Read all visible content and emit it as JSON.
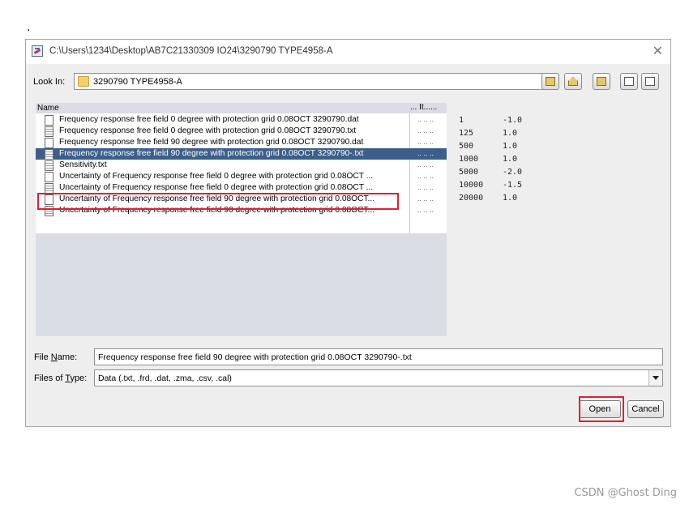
{
  "page_mark": ".",
  "window": {
    "title": "C:\\Users\\1234\\Desktop\\AB7C21330309 IO24\\3290790 TYPE4958-A",
    "close_glyph": "✕",
    "icon": "java-app-icon"
  },
  "look_in": {
    "label": "Look In:",
    "value": "3290790 TYPE4958-A",
    "icon": "folder-icon"
  },
  "toolbar": {
    "buttons": [
      "up-folder-icon",
      "home-icon",
      "new-folder-icon",
      "list-view-icon",
      "details-view-icon"
    ]
  },
  "file_list": {
    "name_header": "Name",
    "type_header": "... It......",
    "items": [
      {
        "name": "Frequency response free field 0 degree with  protection grid 0.08OCT 3290790.dat",
        "extra": ".. .. ..",
        "icon": "blank-doc-icon"
      },
      {
        "name": "Frequency response free field 0 degree with  protection grid 0.08OCT 3290790.txt",
        "extra": ".. .. ..",
        "icon": "text-doc-icon"
      },
      {
        "name": "Frequency response free field 90 degree with  protection grid 0.08OCT 3290790.dat",
        "extra": ".. .. ..",
        "icon": "blank-doc-icon"
      },
      {
        "name": "Frequency response free field 90 degree with  protection grid 0.08OCT 3290790-.txt",
        "extra": ".. .. ..",
        "icon": "text-doc-icon",
        "selected": true
      },
      {
        "name": "Sensitivity.txt",
        "extra": ".. .. ..",
        "icon": "text-doc-icon"
      },
      {
        "name": "Uncertainty of Frequency response free field 0 degree with  protection grid 0.08OCT ...",
        "extra": ".. .. ..",
        "icon": "blank-doc-icon"
      },
      {
        "name": "Uncertainty of Frequency response free field 0 degree with  protection grid 0.08OCT ...",
        "extra": ".. .. ..",
        "icon": "text-doc-icon"
      },
      {
        "name": "Uncertainty of Frequency response free field 90 degree with  protection grid 0.08OCT...",
        "extra": ".. .. ..",
        "icon": "blank-doc-icon"
      },
      {
        "name": "Uncertainty of Frequency response free field 90 degree with  protection grid 0.08OCT...",
        "extra": ".. .. ..",
        "icon": "text-doc-icon"
      }
    ]
  },
  "preview": {
    "rows": [
      {
        "x": "1",
        "y": "-1.0"
      },
      {
        "x": "125",
        "y": "1.0"
      },
      {
        "x": "500",
        "y": "1.0"
      },
      {
        "x": "1000",
        "y": "1.0"
      },
      {
        "x": "5000",
        "y": "-2.0"
      },
      {
        "x": "10000",
        "y": "-1.5"
      },
      {
        "x": "20000",
        "y": "1.0"
      }
    ]
  },
  "file_name": {
    "label_prefix": "File ",
    "label_mnemonic": "N",
    "label_suffix": "ame:",
    "value": "Frequency response free field 90 degree with  protection grid 0.08OCT 3290790-.txt"
  },
  "file_type": {
    "label_prefix": "Files of ",
    "label_mnemonic": "T",
    "label_suffix": "ype:",
    "value": "Data (.txt, .frd, .dat, .zma, .csv, .cal)"
  },
  "buttons": {
    "open": "Open",
    "cancel": "Cancel"
  },
  "highlight_color": "#e02030",
  "selection_color": "#3c5f8a",
  "watermark": "CSDN @Ghost Ding"
}
